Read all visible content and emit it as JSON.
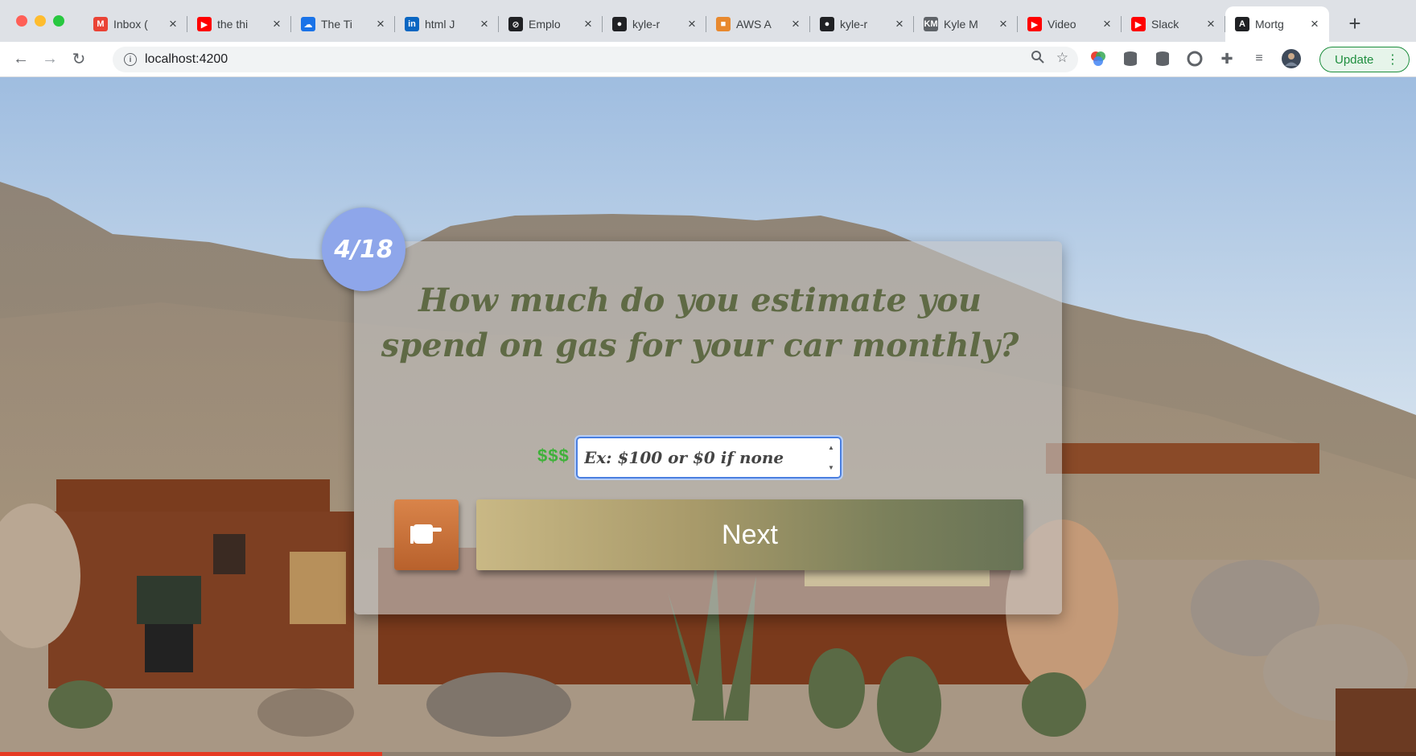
{
  "browser": {
    "tabs": [
      {
        "title": "Inbox (",
        "favicon": "gmail-icon",
        "color": "#ea4335",
        "glyph": "M"
      },
      {
        "title": "the thi",
        "favicon": "youtube-icon",
        "color": "#ff0000",
        "glyph": "▶"
      },
      {
        "title": "The Ti",
        "favicon": "cloud-icon",
        "color": "#1a73e8",
        "glyph": "☁"
      },
      {
        "title": "html J",
        "favicon": "linkedin-icon",
        "color": "#0a66c2",
        "glyph": "in"
      },
      {
        "title": "Emplo",
        "favicon": "blocked-icon",
        "color": "#202124",
        "glyph": "⊘"
      },
      {
        "title": "kyle-r",
        "favicon": "github-icon",
        "color": "#202124",
        "glyph": "●"
      },
      {
        "title": "AWS A",
        "favicon": "aws-box-icon",
        "color": "#e8892e",
        "glyph": "■"
      },
      {
        "title": "kyle-r",
        "favicon": "github-icon",
        "color": "#202124",
        "glyph": "●"
      },
      {
        "title": "Kyle M",
        "favicon": "km-icon",
        "color": "#5f6368",
        "glyph": "KM"
      },
      {
        "title": "Video",
        "favicon": "youtube-icon",
        "color": "#ff0000",
        "glyph": "▶"
      },
      {
        "title": "Slack",
        "favicon": "youtube-icon",
        "color": "#ff0000",
        "glyph": "▶"
      },
      {
        "title": "Mortg",
        "favicon": "angular-icon",
        "color": "#202124",
        "glyph": "A",
        "active": true
      }
    ],
    "url": "localhost:4200",
    "update_label": "Update"
  },
  "quiz": {
    "step": "4/18",
    "question": "How much do you estimate you spend on gas for your car monthly?",
    "currency_label": "$$$",
    "input_placeholder": "Ex: $100 or $0 if none",
    "input_value": "",
    "next_label": "Next",
    "progress_fraction": 0.27
  }
}
